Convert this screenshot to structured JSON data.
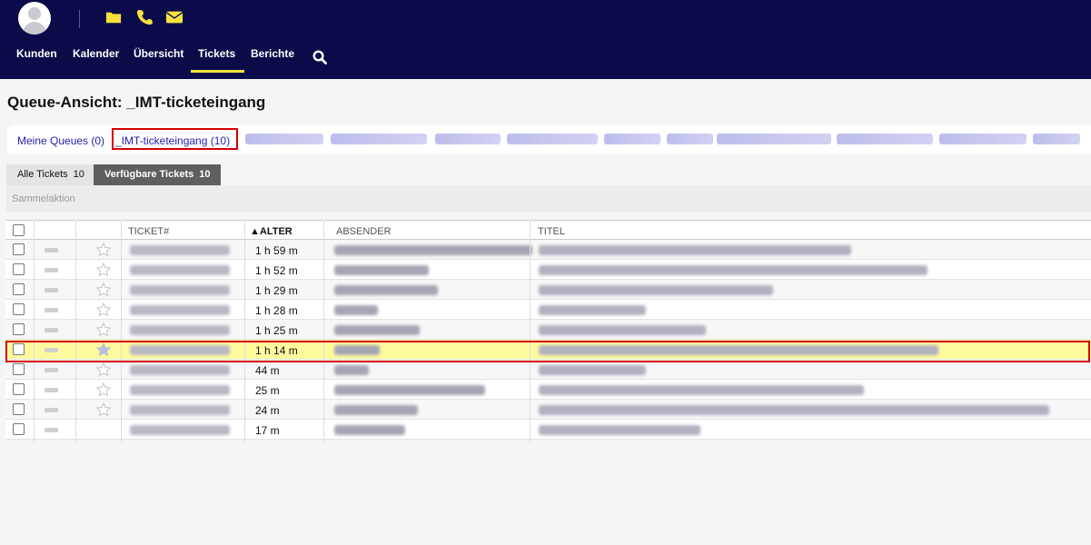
{
  "header": {
    "nav": [
      "Kunden",
      "Kalender",
      "Übersicht",
      "Tickets",
      "Berichte"
    ],
    "active_nav": "Tickets",
    "accent_color": "#f7e23d",
    "background_color": "#0b0b4a",
    "icons": [
      "avatar",
      "folder-icon",
      "phone-icon",
      "mail-icon",
      "search-icon"
    ]
  },
  "page": {
    "title": "Queue-Ansicht: _IMT-ticketeingang"
  },
  "queues": {
    "my_queues": "Meine Queues (0)",
    "current": "_IMT-ticketeingang (10)"
  },
  "tabs": {
    "all": "Alle Tickets",
    "all_count": "10",
    "available": "Verfügbare Tickets",
    "available_count": "10",
    "active": "available"
  },
  "bulk_action": "Sammelaktion",
  "table": {
    "columns": [
      "TICKET#",
      "▲ALTER",
      "ABSENDER",
      "TITEL"
    ],
    "sorted_column": "▲ALTER",
    "rows": [
      {
        "age": "1 h 59 m",
        "highlighted": false
      },
      {
        "age": "1 h 52 m",
        "highlighted": false
      },
      {
        "age": "1 h 29 m",
        "highlighted": false
      },
      {
        "age": "1 h 28 m",
        "highlighted": false
      },
      {
        "age": "1 h 25 m",
        "highlighted": false
      },
      {
        "age": "1 h 14 m",
        "highlighted": true
      },
      {
        "age": "44 m",
        "highlighted": false
      },
      {
        "age": "25 m",
        "highlighted": false
      },
      {
        "age": "24 m",
        "highlighted": false
      },
      {
        "age": "17 m",
        "highlighted": false
      }
    ]
  },
  "highlight_color": "#d40000"
}
